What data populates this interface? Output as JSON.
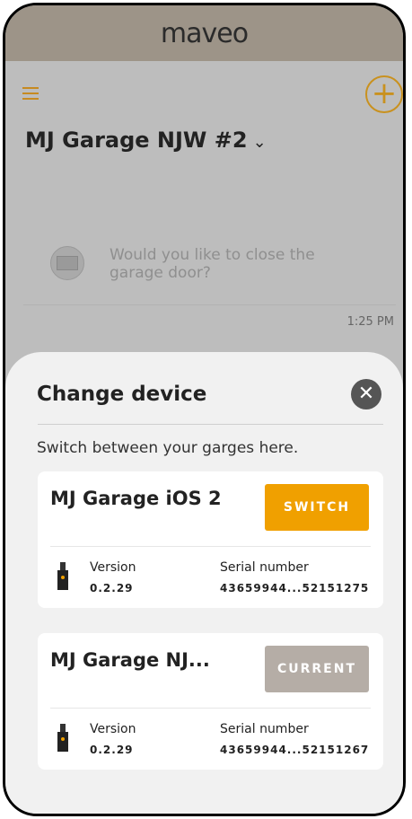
{
  "app": {
    "logo": "maveo"
  },
  "header": {
    "garage_name": "MJ Garage NJW #2"
  },
  "chat": {
    "message": "Would you like to close the garage door?",
    "time": "1:25 PM"
  },
  "sheet": {
    "title": "Change device",
    "subtitle": "Switch between your garges here.",
    "devices": [
      {
        "name": "MJ Garage iOS 2",
        "button": "SWITCH",
        "version_label": "Version",
        "version": "0.2.29",
        "serial_label": "Serial number",
        "serial": "43659944...52151275"
      },
      {
        "name": "MJ Garage NJ...",
        "button": "CURRENT",
        "version_label": "Version",
        "version": "0.2.29",
        "serial_label": "Serial number",
        "serial": "43659944...52151267"
      }
    ]
  },
  "colors": {
    "accent": "#f0a000",
    "current_button": "#b5ada6",
    "header": "#9d9488"
  }
}
